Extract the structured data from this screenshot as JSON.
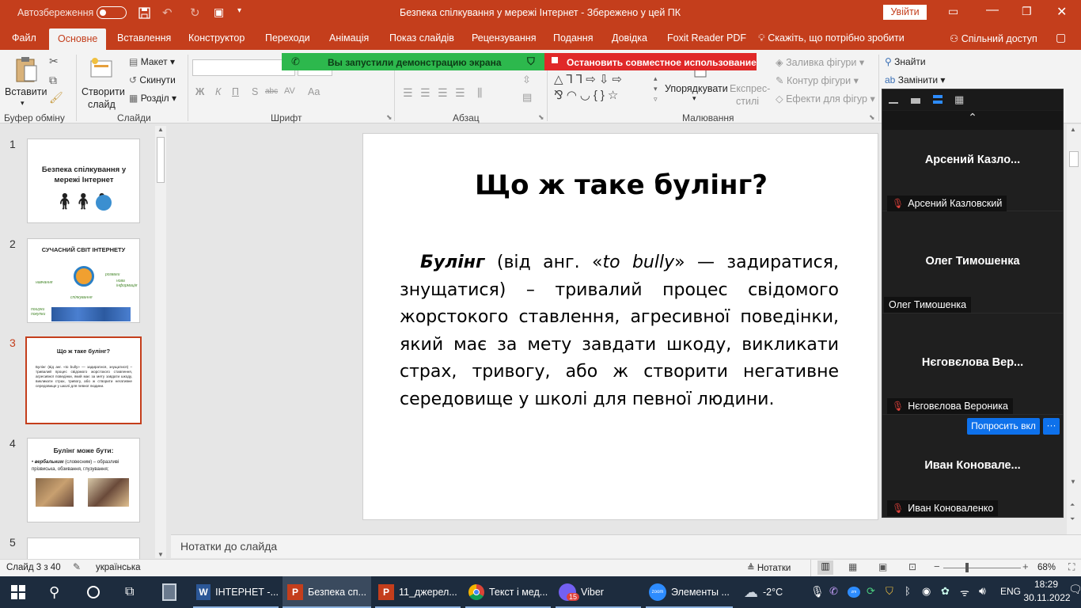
{
  "titlebar": {
    "autosave": "Автозбереження",
    "toggle_state": "off",
    "title": "Безпека спілкування у мережі Інтернет  -  Збережено у цей ПК",
    "signin": "Увійти"
  },
  "tabs": [
    "Файл",
    "Основне",
    "Вставлення",
    "Конструктор",
    "Переходи",
    "Анімація",
    "Показ слайдів",
    "Рецензування",
    "Подання",
    "Довідка",
    "Foxit Reader PDF"
  ],
  "tell_me": "Скажіть, що потрібно зробити",
  "share": "Спільний доступ",
  "ribbon": {
    "paste": "Вставити",
    "clipboard": "Буфер обміну",
    "new_slide_1": "Створити",
    "new_slide_2": "слайд",
    "layout": "Макет",
    "reset": "Скинути",
    "section": "Розділ",
    "slides": "Слайди",
    "font": "Шрифт",
    "font_btns": [
      "Ж",
      "К",
      "П",
      "S",
      "abc",
      "AV",
      "Aa"
    ],
    "paragraph": "Абзац",
    "arrange": "Упорядкувати",
    "quick_styles_1": "Експрес-",
    "quick_styles_2": "стилі",
    "fill": "Заливка фігури",
    "outline": "Контур фігури",
    "effects": "Ефекти для фігур",
    "drawing": "Малювання",
    "find": "Знайти",
    "replace": "Замінити"
  },
  "share_banner": {
    "green": "Вы запустили демонстрацию экрана",
    "red": "Остановить совместное использование"
  },
  "thumbs": [
    {
      "num": "1",
      "title": "Безпека спілкування у мережі Інтернет"
    },
    {
      "num": "2",
      "title": "СУЧАСНИЙ СВІТ ІНТЕРНЕТУ",
      "labels": [
        "навчання",
        "розваги",
        "нова інформація",
        "спілкування",
        "пошуки покупки"
      ]
    },
    {
      "num": "3",
      "title": "Що ж таке булінг?",
      "body": "Булінг (від анг. «to bully» — задиратися, знущатися) – тривалий процес свідомого жорстокого ставлення, агресивної поведінки, який має за мету завдати шкоду, викликати страх, тривогу, або ж створити негативне середовище у школі для певної людини."
    },
    {
      "num": "4",
      "title": "Булінг може бути:",
      "bullet_bold": "вербальним",
      "bullet_rest": " (словесним) – образливі прізвиська, обзивання, глузування;"
    },
    {
      "num": "5"
    }
  ],
  "slide": {
    "title": "Що ж таке булінг?",
    "term": "Булінг",
    "p1": " (від анг. «",
    "italic": "to bully",
    "p2": "» — задиратися, знущатися) – тривалий процес свідомого жорстокого ставлення, агресивної поведінки, який має за мету завдати шкоду, викликати страх, тривогу, або ж створити негативне середовище у школі для певної людини."
  },
  "notes_placeholder": "Нотатки до слайда",
  "status": {
    "slide": "Слайд 3 з 40",
    "lang": "українська",
    "notes": "Нотатки",
    "zoom": "68%"
  },
  "zoom_panel": {
    "participants": [
      {
        "display": "Арсений  Казло...",
        "tag": "Арсений Казловский",
        "muted": true
      },
      {
        "display": "Олег Тимошенка",
        "tag": "Олег Тимошенка",
        "muted": false
      },
      {
        "display": "Нєговєлова Вер...",
        "tag": "Нєговєлова Вероника",
        "muted": true
      },
      {
        "display": "Иван  Коновале...",
        "tag": "Иван Коноваленко",
        "muted": true
      }
    ],
    "ask_btn": "Попросить вкл",
    "more": "···"
  },
  "taskbar": {
    "items": [
      {
        "label": "ІНТЕРНЕТ -...",
        "icon": "word"
      },
      {
        "label": "Безпека сп...",
        "icon": "powerpoint"
      },
      {
        "label": "11_джерел...",
        "icon": "powerpoint"
      },
      {
        "label": "Текст і мед...",
        "icon": "chrome"
      },
      {
        "label": "Viber",
        "icon": "viber",
        "badge": "15"
      },
      {
        "label": "Элементы ...",
        "icon": "zoom"
      }
    ],
    "weather": "-2°C",
    "lang": "ENG",
    "time": "18:29",
    "date": "30.11.2022"
  },
  "colors": {
    "accent": "#c43e1c",
    "taskbar": "#1d2c3e",
    "zoom_blue": "#0e71eb",
    "share_green": "#2db84d",
    "share_red": "#e02828"
  }
}
